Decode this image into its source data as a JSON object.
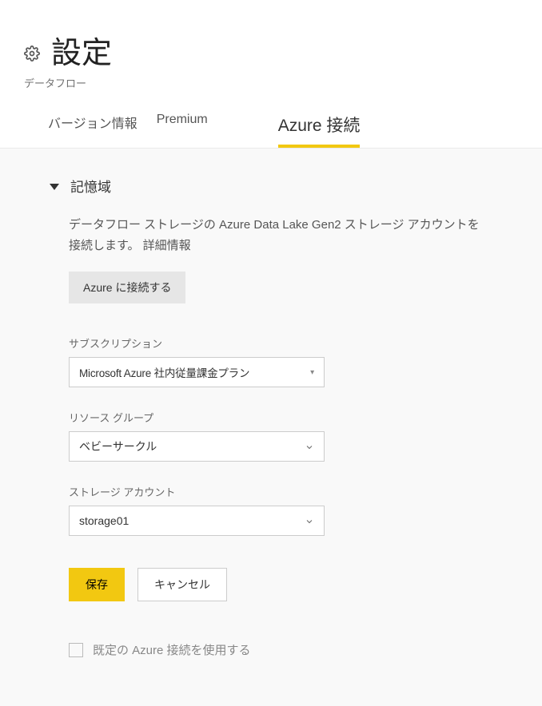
{
  "header": {
    "title": "設定",
    "subtitle": "データフロー"
  },
  "tabs": {
    "version": "バージョン情報",
    "premium": "Premium",
    "azure": "Azure 接続"
  },
  "storage": {
    "section_title": "記憶域",
    "description": "データフロー ストレージの Azure Data Lake Gen2 ストレージ アカウントを接続します。 詳細情報",
    "connect_button": "Azure に接続する",
    "subscription": {
      "label": "サブスクリプション",
      "value": "Microsoft Azure 社内従量課金プラン"
    },
    "resource_group": {
      "label": "リソース グループ",
      "value": "ベビーサークル"
    },
    "storage_account": {
      "label": "ストレージ アカウント",
      "value": "storage01"
    },
    "save_button": "保存",
    "cancel_button": "キャンセル",
    "use_default_checkbox": "既定の Azure 接続を使用する"
  }
}
